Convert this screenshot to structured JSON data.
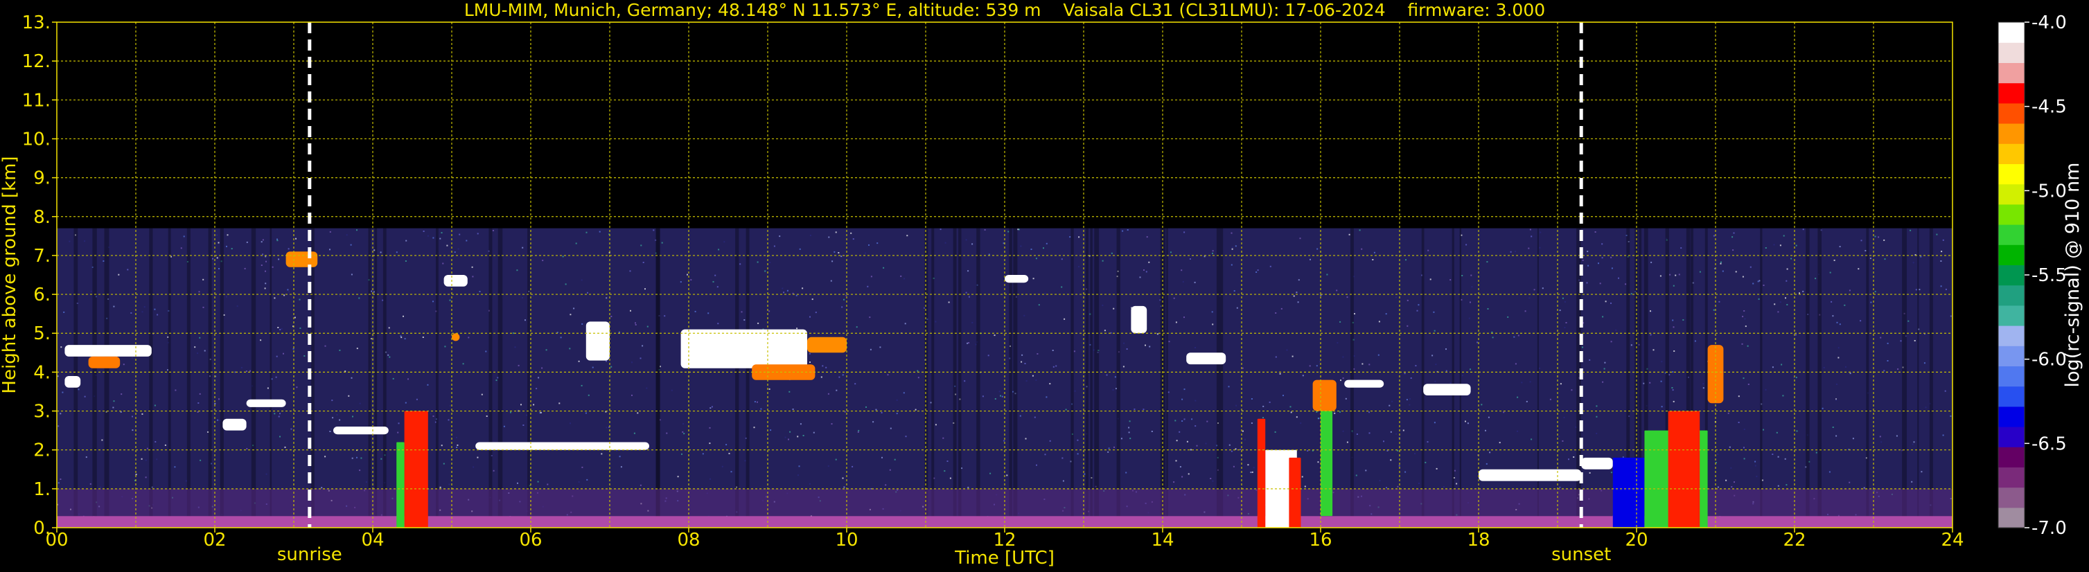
{
  "chart_data": {
    "type": "heatmap",
    "title": "LMU-MIM, Munich, Germany; 48.148° N 11.573° E, altitude: 539 m    Vaisala CL31 (CL31LMU): 17-06-2024    firmware: 3.000",
    "xlabel": "Time [UTC]",
    "ylabel": "Height above ground [km]",
    "xlim": [
      0,
      24
    ],
    "ylim": [
      0,
      13
    ],
    "x_ticks": [
      "00",
      "02",
      "04",
      "06",
      "08",
      "10",
      "12",
      "14",
      "16",
      "18",
      "20",
      "22",
      "24"
    ],
    "y_ticks": [
      "0.",
      "1.",
      "2.",
      "3.",
      "4.",
      "5.",
      "6.",
      "7.",
      "8.",
      "9.",
      "10.",
      "11.",
      "12.",
      "13."
    ],
    "grid": true,
    "data_max_height_km": 7.7,
    "colorbar": {
      "label": "log(rc-signal) @ 910 nm",
      "range": [
        -7.0,
        -4.0
      ],
      "ticks": [
        "-4.0",
        "-4.5",
        "-5.0",
        "-5.5",
        "-6.0",
        "-6.5",
        "-7.0"
      ],
      "colors": [
        "#a08ca0",
        "#8c5a8c",
        "#7a2a7a",
        "#640064",
        "#2800c8",
        "#0000e6",
        "#2850f0",
        "#5078f0",
        "#7896f0",
        "#a0b4f0",
        "#40b4a0",
        "#20a080",
        "#009650",
        "#00b400",
        "#32d232",
        "#78e600",
        "#d2f000",
        "#ffff00",
        "#ffc800",
        "#ff9600",
        "#ff5000",
        "#ff0000",
        "#f0a0a0",
        "#f0dcdc",
        "#ffffff"
      ]
    },
    "markers": [
      {
        "label": "sunrise",
        "time_utc": 3.2
      },
      {
        "label": "sunset",
        "time_utc": 19.3
      }
    ],
    "layers": [
      {
        "type": "aerosol_ground",
        "t0": 0,
        "t1": 24,
        "h0": 0,
        "h1": 0.3,
        "color": "#b04aa8"
      },
      {
        "type": "cloud",
        "t0": 0.1,
        "t1": 1.2,
        "h0": 4.4,
        "h1": 4.7,
        "color": "#ffffff"
      },
      {
        "type": "cloud",
        "t0": 0.4,
        "t1": 0.8,
        "h0": 4.1,
        "h1": 4.4,
        "color": "#ff7a00"
      },
      {
        "type": "cloud",
        "t0": 0.1,
        "t1": 0.3,
        "h0": 3.6,
        "h1": 3.9,
        "color": "#ffffff"
      },
      {
        "type": "cloud",
        "t0": 2.1,
        "t1": 2.4,
        "h0": 2.5,
        "h1": 2.8,
        "color": "#ffffff"
      },
      {
        "type": "cloud",
        "t0": 2.4,
        "t1": 2.9,
        "h0": 3.1,
        "h1": 3.3,
        "color": "#ffffff"
      },
      {
        "type": "cloud",
        "t0": 2.9,
        "t1": 3.3,
        "h0": 6.7,
        "h1": 7.1,
        "color": "#ff8c00"
      },
      {
        "type": "cloud",
        "t0": 3.5,
        "t1": 4.2,
        "h0": 2.4,
        "h1": 2.6,
        "color": "#ffffff"
      },
      {
        "type": "rain",
        "t0": 4.4,
        "t1": 4.7,
        "h0": 0,
        "h1": 3.0,
        "color": "#ff2000"
      },
      {
        "type": "rain",
        "t0": 4.3,
        "t1": 4.4,
        "h0": 0,
        "h1": 2.2,
        "color": "#32d232"
      },
      {
        "type": "cloud",
        "t0": 4.9,
        "t1": 5.2,
        "h0": 6.2,
        "h1": 6.5,
        "color": "#ffffff"
      },
      {
        "type": "cloud",
        "t0": 5.0,
        "t1": 5.1,
        "h0": 4.8,
        "h1": 5.0,
        "color": "#ff8c00"
      },
      {
        "type": "cloud",
        "t0": 5.3,
        "t1": 7.5,
        "h0": 2.0,
        "h1": 2.2,
        "color": "#ffffff"
      },
      {
        "type": "cloud",
        "t0": 6.7,
        "t1": 7.0,
        "h0": 4.3,
        "h1": 5.3,
        "color": "#ffffff"
      },
      {
        "type": "cloud",
        "t0": 7.9,
        "t1": 9.5,
        "h0": 4.1,
        "h1": 5.1,
        "color": "#ffffff"
      },
      {
        "type": "cloud",
        "t0": 8.8,
        "t1": 9.6,
        "h0": 3.8,
        "h1": 4.2,
        "color": "#ff7a00"
      },
      {
        "type": "cloud",
        "t0": 9.5,
        "t1": 10.0,
        "h0": 4.5,
        "h1": 4.9,
        "color": "#ff8c00"
      },
      {
        "type": "cloud",
        "t0": 12.0,
        "t1": 12.3,
        "h0": 6.3,
        "h1": 6.5,
        "color": "#ffffff"
      },
      {
        "type": "cloud",
        "t0": 13.6,
        "t1": 13.8,
        "h0": 5.0,
        "h1": 5.7,
        "color": "#ffffff"
      },
      {
        "type": "cloud",
        "t0": 14.3,
        "t1": 14.8,
        "h0": 4.2,
        "h1": 4.5,
        "color": "#ffffff"
      },
      {
        "type": "rain",
        "t0": 15.3,
        "t1": 15.7,
        "h0": 0,
        "h1": 2.0,
        "color": "#ffffff"
      },
      {
        "type": "rain",
        "t0": 15.2,
        "t1": 15.3,
        "h0": 0,
        "h1": 2.8,
        "color": "#ff2000"
      },
      {
        "type": "rain",
        "t0": 15.6,
        "t1": 15.75,
        "h0": 0,
        "h1": 1.8,
        "color": "#ff2000"
      },
      {
        "type": "rain",
        "t0": 16.0,
        "t1": 16.15,
        "h0": 0.3,
        "h1": 3.1,
        "color": "#32d232"
      },
      {
        "type": "cloud",
        "t0": 15.9,
        "t1": 16.2,
        "h0": 3.0,
        "h1": 3.8,
        "color": "#ff7a00"
      },
      {
        "type": "cloud",
        "t0": 16.3,
        "t1": 16.8,
        "h0": 3.6,
        "h1": 3.8,
        "color": "#ffffff"
      },
      {
        "type": "cloud",
        "t0": 17.3,
        "t1": 17.9,
        "h0": 3.4,
        "h1": 3.7,
        "color": "#ffffff"
      },
      {
        "type": "cloud",
        "t0": 18.0,
        "t1": 19.3,
        "h0": 1.2,
        "h1": 1.5,
        "color": "#ffffff"
      },
      {
        "type": "cloud",
        "t0": 19.3,
        "t1": 19.7,
        "h0": 1.5,
        "h1": 1.8,
        "color": "#ffffff"
      },
      {
        "type": "rain",
        "t0": 19.7,
        "t1": 20.1,
        "h0": 0,
        "h1": 1.8,
        "color": "#0000e6"
      },
      {
        "type": "rain",
        "t0": 20.1,
        "t1": 20.9,
        "h0": 0,
        "h1": 2.5,
        "color": "#32d232"
      },
      {
        "type": "rain",
        "t0": 20.4,
        "t1": 20.8,
        "h0": 0,
        "h1": 3.0,
        "color": "#ff2000"
      },
      {
        "type": "cloud",
        "t0": 20.9,
        "t1": 21.1,
        "h0": 3.2,
        "h1": 4.7,
        "color": "#ff7a00"
      }
    ]
  }
}
